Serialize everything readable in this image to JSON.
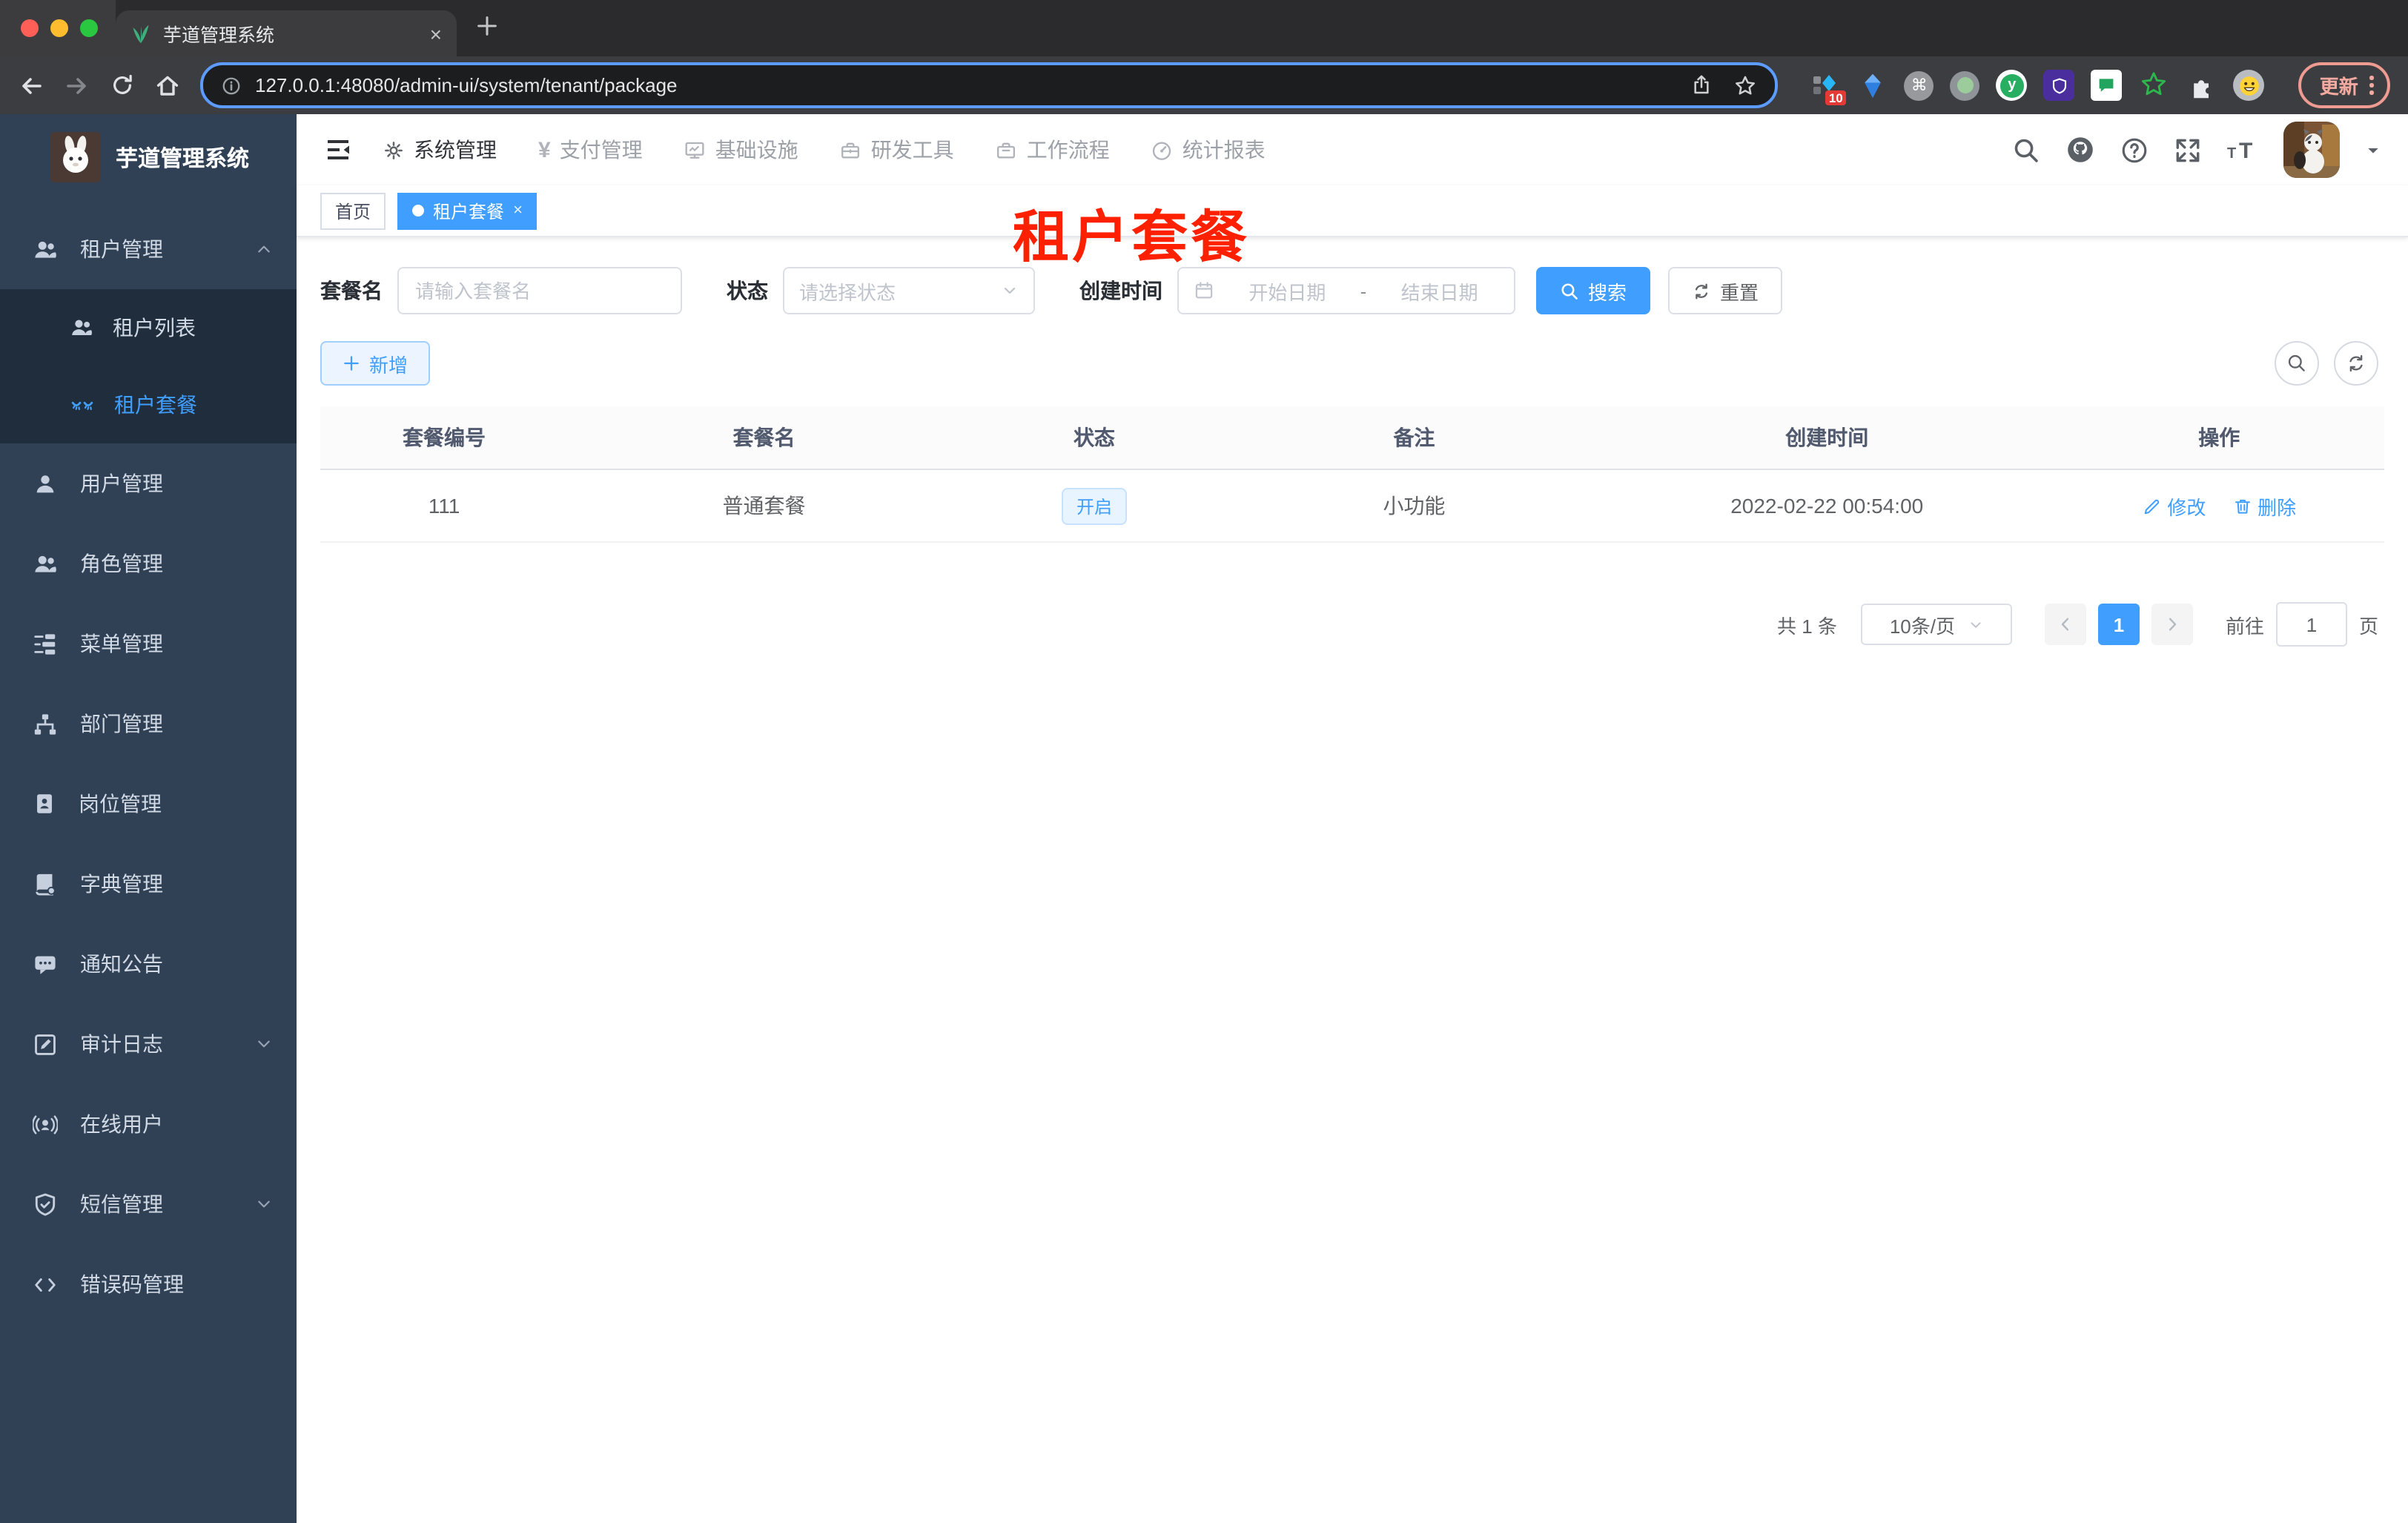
{
  "browser": {
    "tab_title": "芋道管理系统",
    "tab_close": "×",
    "url": "127.0.0.1:48080/admin-ui/system/tenant/package",
    "extensions_badge": "10",
    "ext_y_letter": "y",
    "ext_cmd_symbol": "⌘",
    "update_button": "更新"
  },
  "sidebar": {
    "title": "芋道管理系统",
    "items": [
      {
        "label": "租户管理"
      },
      {
        "label": "租户列表"
      },
      {
        "label": "租户套餐"
      },
      {
        "label": "用户管理"
      },
      {
        "label": "角色管理"
      },
      {
        "label": "菜单管理"
      },
      {
        "label": "部门管理"
      },
      {
        "label": "岗位管理"
      },
      {
        "label": "字典管理"
      },
      {
        "label": "通知公告"
      },
      {
        "label": "审计日志"
      },
      {
        "label": "在线用户"
      },
      {
        "label": "短信管理"
      },
      {
        "label": "错误码管理"
      }
    ]
  },
  "topnav": {
    "items": [
      {
        "label": "系统管理",
        "yen": ""
      },
      {
        "label": "支付管理",
        "yen": "¥"
      },
      {
        "label": "基础设施"
      },
      {
        "label": "研发工具"
      },
      {
        "label": "工作流程"
      },
      {
        "label": "统计报表"
      }
    ]
  },
  "tags": {
    "home": "首页",
    "active": "租户套餐",
    "close": "×"
  },
  "annotation": "租户套餐",
  "filters": {
    "name_label": "套餐名",
    "name_placeholder": "请输入套餐名",
    "status_label": "状态",
    "status_placeholder": "请选择状态",
    "created_label": "创建时间",
    "start_placeholder": "开始日期",
    "range_separator": "-",
    "end_placeholder": "结束日期",
    "search": "搜索",
    "reset": "重置",
    "add": "新增"
  },
  "table": {
    "headers": [
      "套餐编号",
      "套餐名",
      "状态",
      "备注",
      "创建时间",
      "操作"
    ],
    "rows": [
      {
        "id": "111",
        "name": "普通套餐",
        "status": "开启",
        "remark": "小功能",
        "created": "2022-02-22 00:54:00"
      }
    ],
    "row_actions": [
      "修改",
      "删除"
    ]
  },
  "pagination": {
    "total": "共 1 条",
    "page_size": "10条/页",
    "current_page": "1",
    "goto_label": "前往",
    "goto_value": "1",
    "unit_label": "页"
  }
}
